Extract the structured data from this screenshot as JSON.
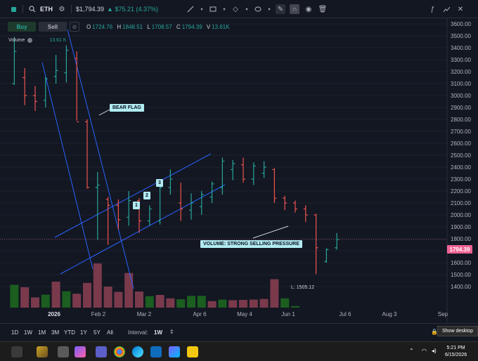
{
  "toolbar": {
    "symbol": "ETH",
    "price": "$1,794.39",
    "change": "▲ $75.21 (4.37%)",
    "icons": [
      "square-icon",
      "search-icon",
      "settings-icon",
      "line-tool-icon",
      "rectangle-tool-icon",
      "diamond-tool-icon",
      "ellipse-tool-icon",
      "pencil-icon",
      "magnet-icon",
      "eye-icon",
      "trash-icon",
      "formula-icon",
      "trend-icon",
      "close-icon"
    ]
  },
  "trade": {
    "buy_label": "Buy",
    "sell_label": "Sell"
  },
  "ohlc": {
    "o_label": "O",
    "o": "1724.76",
    "h_label": "H",
    "h": "1848.51",
    "l_label": "L",
    "l": "1708.57",
    "c_label": "C",
    "c": "1794.39",
    "v_label": "V",
    "v": "13.61K"
  },
  "volume_legend": {
    "label": "Volume",
    "value": "13.61 K"
  },
  "annotations": {
    "bear_flag": "BEAR FLAG",
    "wave1": "1",
    "wave2": "2",
    "wave3": "3",
    "volume_note": "VOLUME: STRONG SELLING PRESSURE",
    "low_label": "L: 1505.12",
    "current_price": "1794.39"
  },
  "colors": {
    "up": "#26a69a",
    "down": "#ef5350",
    "vol_up": "#1b5e20",
    "vol_down": "#7a3a4c",
    "line": "#2962ff",
    "callout": "#b2ebf2"
  },
  "bottom": {
    "ranges": [
      "1D",
      "1W",
      "1M",
      "3M",
      "YTD",
      "1Y",
      "5Y",
      "All"
    ],
    "interval_label": "Interval:",
    "interval_value": "1W",
    "show_desktop": "Show desktop"
  },
  "clock": {
    "time": "5:21 PM",
    "date": "6/15/2026"
  },
  "chart_data": {
    "type": "ohlc",
    "y_ticks": [
      3600,
      3500,
      3400,
      3300,
      3200,
      3100,
      3000,
      2900,
      2800,
      2700,
      2600,
      2500,
      2400,
      2300,
      2200,
      2100,
      2000,
      1900,
      1800,
      1700,
      1600,
      1500,
      1400
    ],
    "y_tick_labels": [
      "3600.00",
      "3500.00",
      "3400.00",
      "3300.00",
      "3200.00",
      "3100.00",
      "3000.00",
      "2900.00",
      "2800.00",
      "2700.00",
      "2600.00",
      "2500.00",
      "2400.00",
      "2300.00",
      "2200.00",
      "2100.00",
      "2000.00",
      "1900.00",
      "1800.00",
      "1700.00",
      "1600.00",
      "1500.00",
      "1400.00"
    ],
    "ylim": [
      1350,
      3640
    ],
    "x_labels": [
      "2026",
      "Feb 2",
      "Mar 2",
      "Apr 6",
      "May 4",
      "Jun 1",
      "Jul 6",
      "Aug 3",
      "Sep"
    ],
    "bars": [
      {
        "o": 3100,
        "h": 3490,
        "l": 3090,
        "c": 3370
      },
      {
        "o": 3150,
        "h": 3230,
        "l": 2920,
        "c": 3000
      },
      {
        "o": 3000,
        "h": 3080,
        "l": 2870,
        "c": 2950
      },
      {
        "o": 2960,
        "h": 3160,
        "l": 2900,
        "c": 3140
      },
      {
        "o": 3160,
        "h": 3340,
        "l": 3100,
        "c": 3210
      },
      {
        "o": 3190,
        "h": 3420,
        "l": 3110,
        "c": 3380
      },
      {
        "o": 3310,
        "h": 3370,
        "l": 2790,
        "c": 2780
      },
      {
        "o": 2780,
        "h": 2800,
        "l": 2220,
        "c": 2230
      },
      {
        "o": 2230,
        "h": 2360,
        "l": 1790,
        "c": 2250
      },
      {
        "o": 2130,
        "h": 2150,
        "l": 1750,
        "c": 2080
      },
      {
        "o": 2080,
        "h": 2130,
        "l": 1880,
        "c": 1960
      },
      {
        "o": 1980,
        "h": 2200,
        "l": 1910,
        "c": 2120
      },
      {
        "o": 2120,
        "h": 2140,
        "l": 1850,
        "c": 1950
      },
      {
        "o": 1950,
        "h": 2080,
        "l": 1910,
        "c": 2050
      },
      {
        "o": 1950,
        "h": 2280,
        "l": 1920,
        "c": 2230
      },
      {
        "o": 2230,
        "h": 2380,
        "l": 2170,
        "c": 2300
      },
      {
        "o": 2100,
        "h": 2270,
        "l": 1950,
        "c": 2050
      },
      {
        "o": 2040,
        "h": 2180,
        "l": 1960,
        "c": 2100
      },
      {
        "o": 2070,
        "h": 2200,
        "l": 2000,
        "c": 2170
      },
      {
        "o": 2150,
        "h": 2280,
        "l": 2100,
        "c": 2260
      },
      {
        "o": 2230,
        "h": 2480,
        "l": 2170,
        "c": 2450
      },
      {
        "o": 2380,
        "h": 2460,
        "l": 2290,
        "c": 2430
      },
      {
        "o": 2420,
        "h": 2480,
        "l": 2270,
        "c": 2300
      },
      {
        "o": 2300,
        "h": 2440,
        "l": 2250,
        "c": 2410
      },
      {
        "o": 2350,
        "h": 2450,
        "l": 2310,
        "c": 2400
      },
      {
        "o": 2380,
        "h": 2390,
        "l": 2100,
        "c": 2140
      },
      {
        "o": 2140,
        "h": 2160,
        "l": 2040,
        "c": 2100
      },
      {
        "o": 2100,
        "h": 2120,
        "l": 2020,
        "c": 2050
      },
      {
        "o": 2050,
        "h": 2080,
        "l": 1940,
        "c": 2000
      },
      {
        "o": 2000,
        "h": 2010,
        "l": 1505,
        "c": 1725
      },
      {
        "o": 1610,
        "h": 1720,
        "l": 1600,
        "c": 1710
      },
      {
        "o": 1724.76,
        "h": 1848.51,
        "l": 1708.57,
        "c": 1794.39
      }
    ],
    "volume": [
      {
        "v": 7.4,
        "up": true
      },
      {
        "v": 6.6,
        "up": false
      },
      {
        "v": 3.3,
        "up": false
      },
      {
        "v": 4.2,
        "up": true
      },
      {
        "v": 8.4,
        "up": false
      },
      {
        "v": 5.3,
        "up": true
      },
      {
        "v": 4.5,
        "up": false
      },
      {
        "v": 8.0,
        "up": false
      },
      {
        "v": 14.3,
        "up": false
      },
      {
        "v": 6.8,
        "up": false
      },
      {
        "v": 5.1,
        "up": false
      },
      {
        "v": 11.2,
        "up": false
      },
      {
        "v": 5.2,
        "up": false
      },
      {
        "v": 3.7,
        "up": true
      },
      {
        "v": 4.1,
        "up": false
      },
      {
        "v": 3.0,
        "up": false
      },
      {
        "v": 2.7,
        "up": true
      },
      {
        "v": 3.8,
        "up": true
      },
      {
        "v": 3.8,
        "up": true
      },
      {
        "v": 2.1,
        "up": false
      },
      {
        "v": 2.6,
        "up": true
      },
      {
        "v": 2.4,
        "up": false
      },
      {
        "v": 2.5,
        "up": false
      },
      {
        "v": 2.6,
        "up": false
      },
      {
        "v": 2.8,
        "up": false
      },
      {
        "v": 9.2,
        "up": false
      },
      {
        "v": 3.0,
        "up": true
      },
      {
        "v": 0.5,
        "up": true
      }
    ]
  }
}
